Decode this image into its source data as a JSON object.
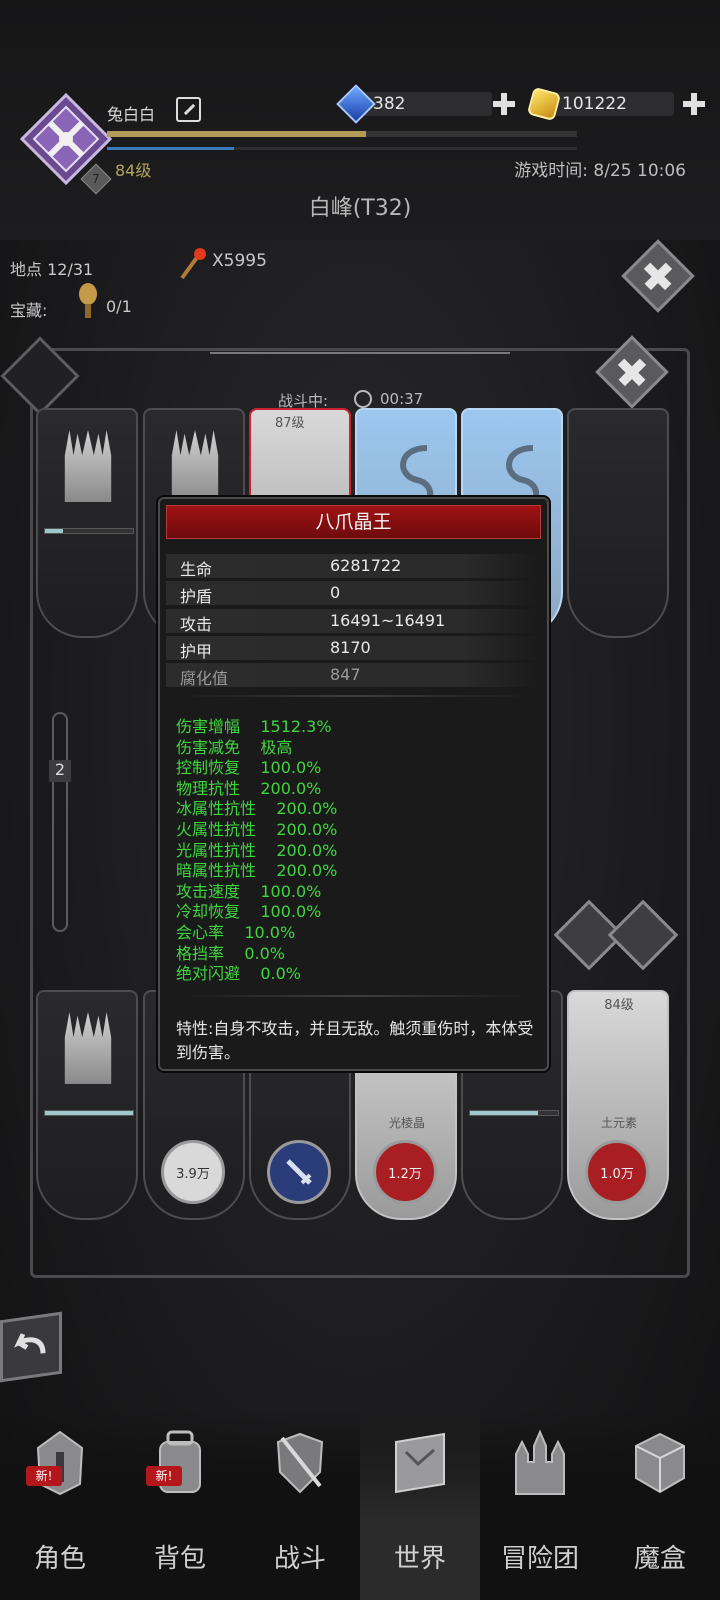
{
  "header": {
    "username": "兔白白",
    "level_label": "84级",
    "avatar_badge": "7",
    "location_title": "白峰(T32)",
    "game_time": "游戏时间: 8/25 10:06",
    "xp_fraction": 0.55,
    "mp_fraction": 0.27,
    "currencies": [
      {
        "icon": "blue-gem-icon",
        "value": "382"
      },
      {
        "icon": "gold-gem-icon",
        "value": "101222"
      }
    ]
  },
  "info": {
    "spot": "地点 12/31",
    "torch_count": "X5995",
    "treasure_label": "宝藏:",
    "treasure_count": "0/1"
  },
  "battle": {
    "status": "战斗中:",
    "timer": "00:37",
    "top_cards": [
      {
        "type": "throne",
        "label": ""
      },
      {
        "type": "throne",
        "label": ""
      },
      {
        "type": "monster",
        "label": "87级"
      },
      {
        "type": "serpent",
        "label": ""
      },
      {
        "type": "serpent",
        "label": ""
      },
      {
        "type": "empty",
        "label": ""
      }
    ],
    "bottom_cards": [
      {
        "type": "throne",
        "label": "",
        "orb": ""
      },
      {
        "type": "hero",
        "label": "",
        "orb": "3.9万"
      },
      {
        "type": "hero",
        "label": "",
        "orb": ""
      },
      {
        "type": "crystal",
        "label": "光棱晶",
        "orb": "1.2万"
      },
      {
        "type": "throne",
        "label": "",
        "orb": ""
      },
      {
        "type": "crystal",
        "label": "土元素",
        "orb": "1.0万",
        "level": "84级"
      }
    ],
    "slider_value": "2"
  },
  "tooltip": {
    "title": "八爪晶王",
    "stats": [
      {
        "label": "生命",
        "value": "6281722"
      },
      {
        "label": "护盾",
        "value": "0"
      },
      {
        "label": "攻击",
        "value": "16491~16491"
      },
      {
        "label": "护甲",
        "value": "8170"
      },
      {
        "label": "腐化值",
        "value": "847"
      }
    ],
    "attributes": [
      {
        "label": "伤害增幅",
        "value": "1512.3%"
      },
      {
        "label": "伤害减免",
        "value": "极高"
      },
      {
        "label": "控制恢复",
        "value": "100.0%"
      },
      {
        "label": "物理抗性",
        "value": "200.0%"
      },
      {
        "label": "冰属性抗性",
        "value": "200.0%"
      },
      {
        "label": "火属性抗性",
        "value": "200.0%"
      },
      {
        "label": "光属性抗性",
        "value": "200.0%"
      },
      {
        "label": "暗属性抗性",
        "value": "200.0%"
      },
      {
        "label": "攻击速度",
        "value": "100.0%"
      },
      {
        "label": "冷却恢复",
        "value": "100.0%"
      },
      {
        "label": "会心率",
        "value": "10.0%"
      },
      {
        "label": "格挡率",
        "value": "0.0%"
      },
      {
        "label": "绝对闪避",
        "value": "0.0%"
      }
    ],
    "trait": "特性:自身不攻击，并且无敌。触须重伤时，本体受到伤害。"
  },
  "nav": [
    {
      "label": "角色",
      "icon": "helmet-icon",
      "badge": "新!"
    },
    {
      "label": "背包",
      "icon": "backpack-icon",
      "badge": "新!"
    },
    {
      "label": "战斗",
      "icon": "shield-sword-icon",
      "badge": ""
    },
    {
      "label": "世界",
      "icon": "map-scroll-icon",
      "badge": ""
    },
    {
      "label": "冒险团",
      "icon": "castle-icon",
      "badge": ""
    },
    {
      "label": "魔盒",
      "icon": "cube-icon",
      "badge": ""
    }
  ]
}
